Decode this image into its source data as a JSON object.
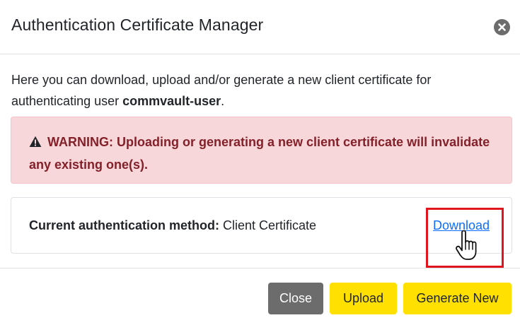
{
  "header": {
    "title": "Authentication Certificate Manager",
    "close_icon": "close-circle-icon"
  },
  "intro": {
    "text_before": "Here you can download, upload and/or generate a new client certificate for authenticating user ",
    "username": "commvault-user",
    "text_after": "."
  },
  "warning": {
    "icon": "warning-triangle-icon",
    "text": "WARNING: Uploading or generating a new client certificate will invalidate any existing one(s)."
  },
  "method": {
    "label": "Current authentication method:",
    "value": "Client Certificate",
    "download_label": "Download"
  },
  "footer": {
    "close_label": "Close",
    "upload_label": "Upload",
    "generate_label": "Generate New"
  },
  "colors": {
    "warning_bg": "#f8d7da",
    "warning_text": "#842029",
    "link": "#0d6efd",
    "highlight": "#e0151d",
    "btn_secondary": "#6c6c6c",
    "btn_yellow": "#ffe000"
  }
}
